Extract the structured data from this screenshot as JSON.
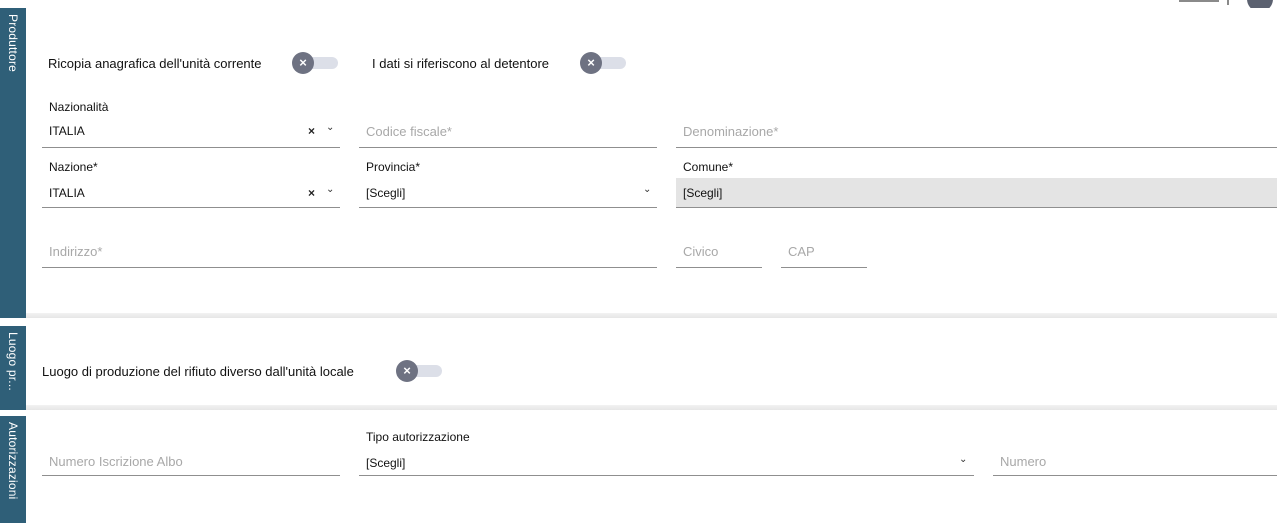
{
  "sections": {
    "produttore": {
      "tab_label": "Produttore",
      "copy_toggle_label": "Ricopia anagrafica dell'unità corrente",
      "holder_toggle_label": "I dati si riferiscono al detentore",
      "nazionalita": {
        "label": "Nazionalità",
        "value": "ITALIA"
      },
      "codice_fiscale": {
        "placeholder": "Codice fiscale*"
      },
      "denominazione": {
        "placeholder": "Denominazione*"
      },
      "nazione": {
        "label": "Nazione*",
        "value": "ITALIA"
      },
      "provincia": {
        "label": "Provincia*",
        "value": "[Scegli]"
      },
      "comune": {
        "label": "Comune*",
        "value": "[Scegli]"
      },
      "indirizzo": {
        "placeholder": "Indirizzo*"
      },
      "civico": {
        "placeholder": "Civico"
      },
      "cap": {
        "placeholder": "CAP"
      }
    },
    "luogo": {
      "tab_label": "Luogo pr...",
      "toggle_label": "Luogo di produzione del rifiuto diverso dall'unità locale"
    },
    "autorizzazioni": {
      "tab_label": "Autorizzazioni",
      "numero_iscrizione": {
        "placeholder": "Numero Iscrizione Albo"
      },
      "tipo_autorizzazione": {
        "label": "Tipo autorizzazione",
        "value": "[Scegli]"
      },
      "numero": {
        "placeholder": "Numero"
      }
    }
  },
  "icons": {
    "toggle_off": "x-icon",
    "clear": "×",
    "dropdown": "⌄"
  },
  "colors": {
    "tab_bg": "#2f5f78",
    "toggle_knob": "#6e7282",
    "toggle_track": "#dcdfe8",
    "filled_field": "#e4e4e4"
  }
}
